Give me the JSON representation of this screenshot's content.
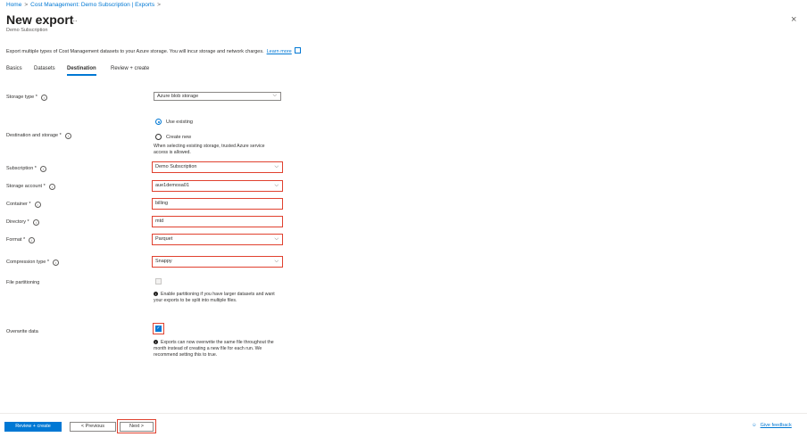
{
  "breadcrumb": {
    "home": "Home",
    "sep": ">",
    "parent": "Cost Management: Demo Subscription | Exports"
  },
  "header": {
    "title": "New export",
    "more": "...",
    "subtitle": "Demo Subscription",
    "close": "×"
  },
  "description": {
    "text": "Export multiple types of Cost Management datasets to your Azure storage. You will incur storage and network charges.",
    "link": "Learn more"
  },
  "tabs": [
    {
      "label": "Basics"
    },
    {
      "label": "Datasets"
    },
    {
      "label": "Destination",
      "active": true
    },
    {
      "label": "Review + create"
    }
  ],
  "form": {
    "storage_type": {
      "label": "Storage type *",
      "value": "Azure blob storage"
    },
    "destination": {
      "label": "Destination and storage *",
      "options": [
        "Use existing",
        "Create new"
      ],
      "selected": "Use existing",
      "note": "When selecting existing storage, trusted Azure service access is allowed."
    },
    "subscription": {
      "label": "Subscription *",
      "value": "Demo Subscription"
    },
    "storage_account": {
      "label": "Storage account *",
      "value": "aue1demosa01"
    },
    "container": {
      "label": "Container *",
      "value": "billing"
    },
    "directory": {
      "label": "Directory *",
      "value": "mtd"
    },
    "format": {
      "label": "Format *",
      "value": "Parquet"
    },
    "compression": {
      "label": "Compression type *",
      "value": "Snappy"
    },
    "file_partitioning": {
      "label": "File partitioning",
      "checked": false,
      "disabled": true,
      "note": "Enable partitioning if you have larger datasets and want your exports to be split into multiple files."
    },
    "overwrite": {
      "label": "Overwrite data",
      "checked": true,
      "note": "Exports can now overwrite the same file throughout the month instead of creating a new file for each run. We recommend setting this to true."
    }
  },
  "footer": {
    "review": "Review + create",
    "previous": "< Previous",
    "next": "Next >",
    "feedback": "Give feedback"
  },
  "colors": {
    "accent": "#0078d4",
    "highlight": "#e0412f"
  }
}
